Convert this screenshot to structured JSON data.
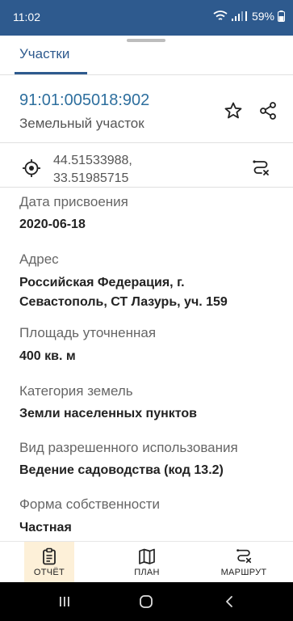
{
  "status_bar": {
    "time": "11:02",
    "battery": "59%"
  },
  "tabs": [
    {
      "label": "Участки"
    }
  ],
  "parcel": {
    "number": "91:01:005018:902",
    "type": "Земельный участок",
    "coords_line1": "44.51533988,",
    "coords_line2": "33.51985715"
  },
  "fields": [
    {
      "label": "Дата присвоения",
      "value": "2020-06-18"
    },
    {
      "label": "Адрес",
      "value": "Российская Федерация, г. Севастополь, СТ Лазурь, уч. 159"
    },
    {
      "label": "Площадь уточненная",
      "value": "400 кв. м"
    },
    {
      "label": "Категория земель",
      "value": "Земли населенных пунктов"
    },
    {
      "label": "Вид разрешенного использования",
      "value": "Ведение садоводства (код 13.2)"
    },
    {
      "label": "Форма собственности",
      "value": "Частная"
    }
  ],
  "bottom_nav": [
    {
      "label": "ОТЧЁТ",
      "icon": "clipboard-icon"
    },
    {
      "label": "ПЛАН",
      "icon": "map-icon"
    },
    {
      "label": "МАРШРУТ",
      "icon": "route-icon"
    }
  ],
  "colors": {
    "primary": "#2e5a8e",
    "link": "#2e6f9e",
    "active_nav_bg": "#fdf0d8"
  }
}
